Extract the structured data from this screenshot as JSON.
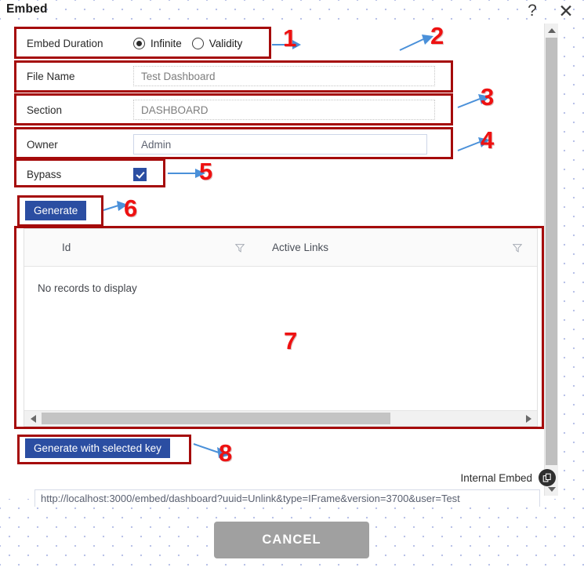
{
  "dialog": {
    "title": "Embed",
    "help_icon": "question-mark-icon",
    "close_icon": "close-icon"
  },
  "form": {
    "duration": {
      "label": "Embed Duration",
      "options": [
        {
          "label": "Infinite",
          "selected": true
        },
        {
          "label": "Validity",
          "selected": false
        }
      ]
    },
    "file_name": {
      "label": "File Name",
      "value": "Test Dashboard"
    },
    "section": {
      "label": "Section",
      "value": "DASHBOARD"
    },
    "owner": {
      "label": "Owner",
      "value": "Admin"
    },
    "bypass": {
      "label": "Bypass",
      "checked": true
    }
  },
  "buttons": {
    "generate": "Generate",
    "generate_with_key": "Generate with selected key",
    "cancel": "CANCEL"
  },
  "grid": {
    "columns": [
      {
        "title": "Id",
        "filter_icon": "filter-icon"
      },
      {
        "title": "Active Links",
        "filter_icon": "filter-icon"
      }
    ],
    "empty_message": "No records to display",
    "rows": []
  },
  "embed_output": {
    "label": "Internal Embed",
    "copy_icon": "copy-icon",
    "url": "http://localhost:3000/embed/dashboard?uuid=Unlink&type=IFrame&version=3700&user=Test"
  },
  "annotations": [
    {
      "number": "1"
    },
    {
      "number": "2"
    },
    {
      "number": "3"
    },
    {
      "number": "4"
    },
    {
      "number": "5"
    },
    {
      "number": "6"
    },
    {
      "number": "7"
    },
    {
      "number": "8"
    }
  ],
  "colors": {
    "accent_blue": "#2b4ea2",
    "annotation_red": "#a50b0b",
    "annotation_number_red": "#ee1111",
    "arrow_blue": "#4a90d9",
    "cancel_gray": "#a0a0a0"
  }
}
